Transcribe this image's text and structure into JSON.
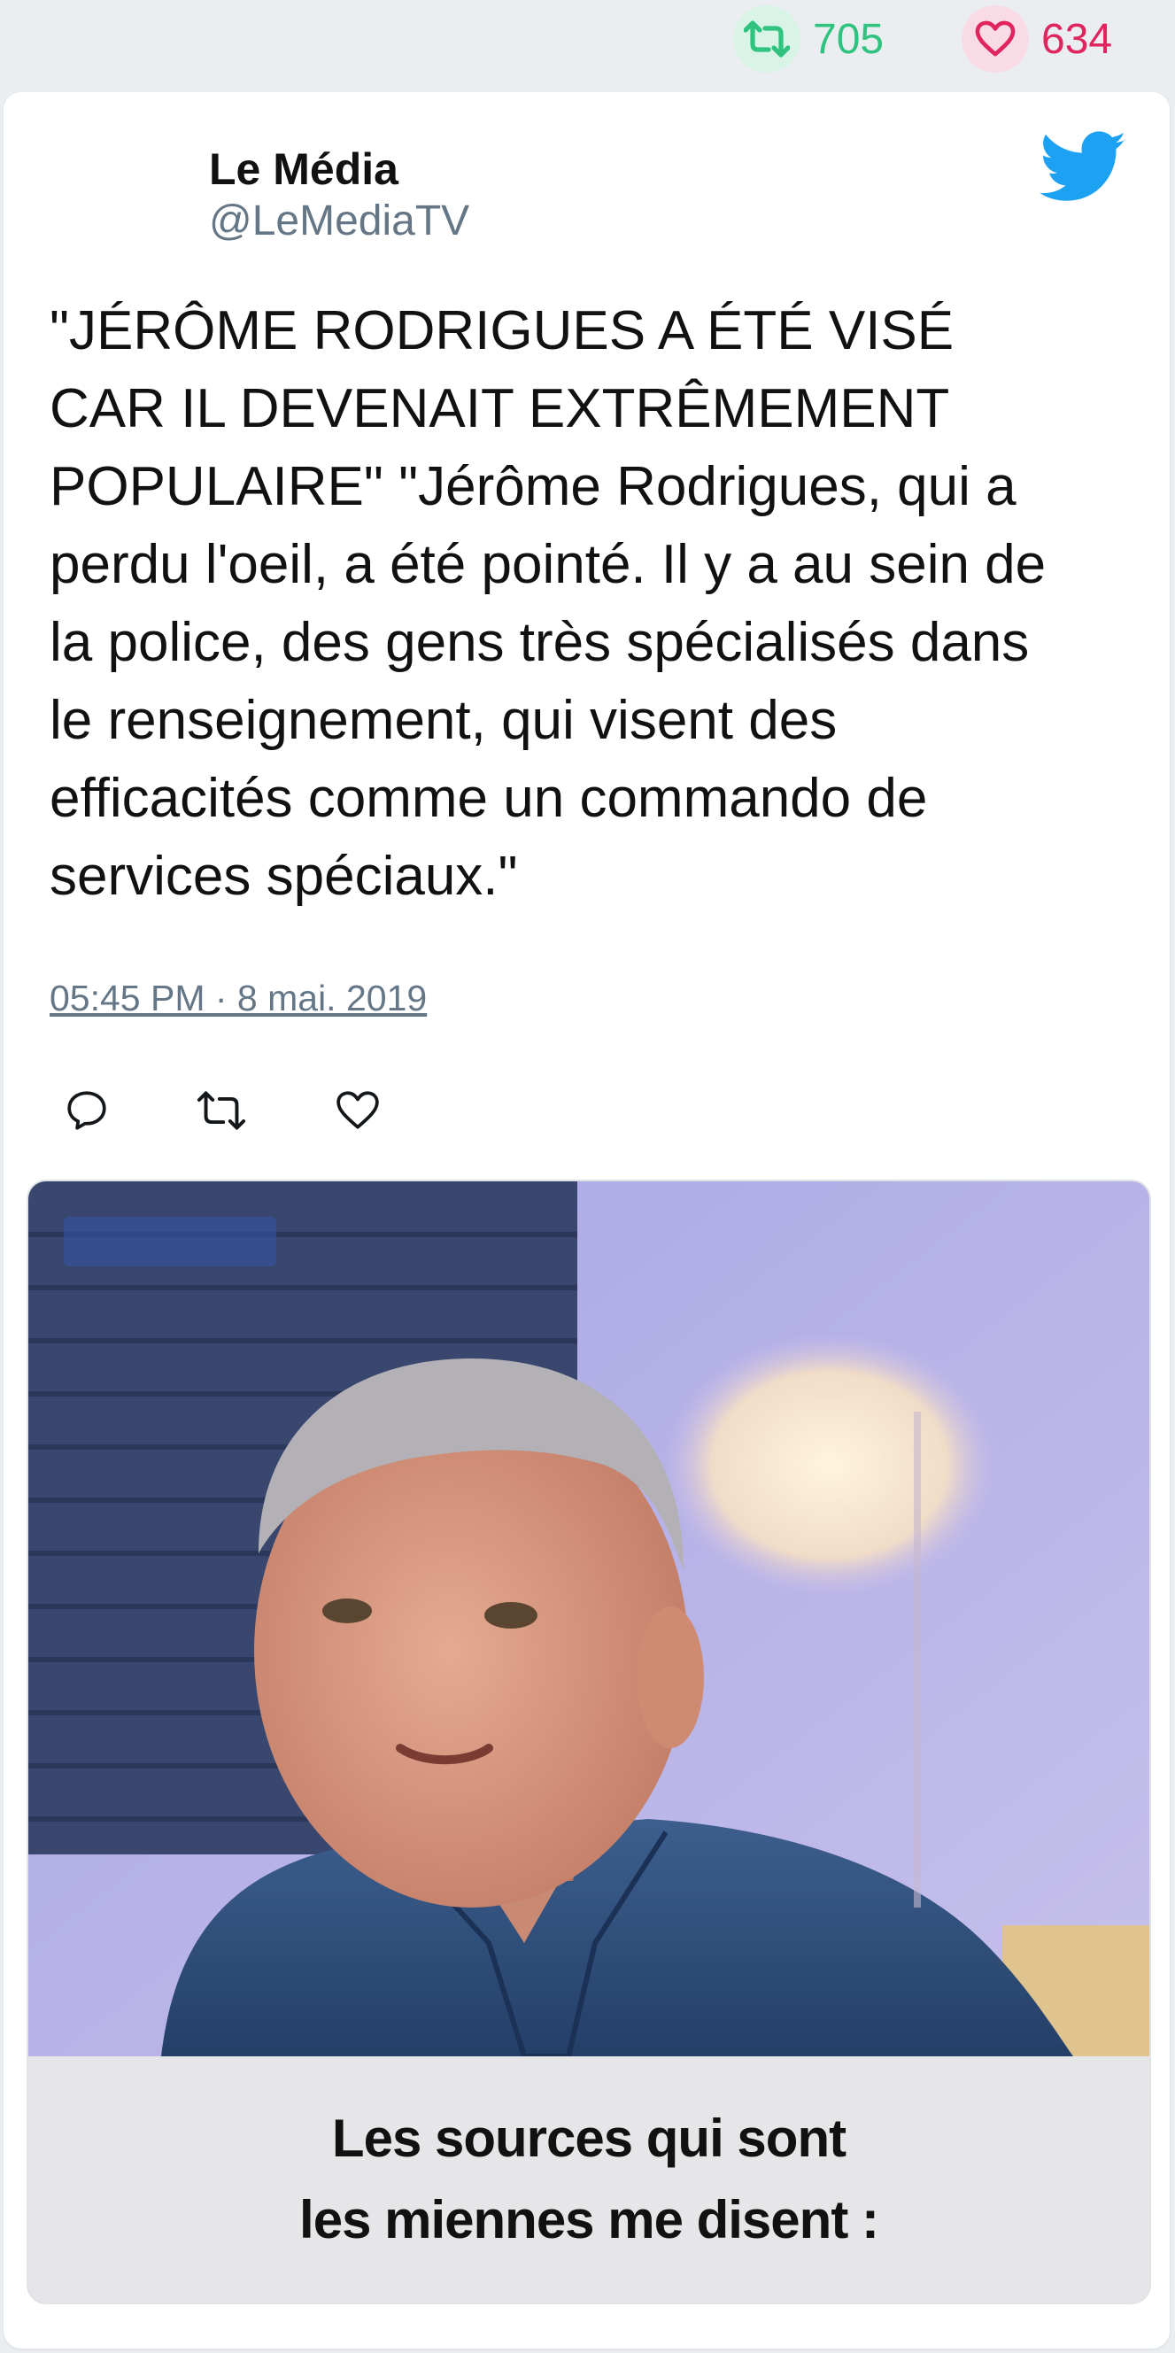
{
  "stats": {
    "retweets": "705",
    "likes": "634",
    "retweet_color": "#2fc37f",
    "like_color": "#e0245e",
    "retweet_icon": "retweet-icon",
    "like_icon": "heart-icon"
  },
  "tweet": {
    "author_name": "Le Média",
    "author_handle": "@LeMediaTV",
    "platform_icon": "twitter-bird-icon",
    "brand_color": "#1da1f2",
    "text": "\"JÉRÔME RODRIGUES A ÉTÉ VISÉ\nCAR IL DEVENAIT EXTRÊMEMENT\nPOPULAIRE\" \"Jérôme Rodrigues, qui a\nperdu l'oeil, a été pointé. Il y a au sein de\nla police, des gens très spécialisés dans\nle renseignement, qui visent des\nefficacités comme un commando de\nservices spéciaux.\"",
    "timestamp": "05:45 PM · 8 mai. 2019",
    "actions": [
      "reply-icon",
      "retweet-icon",
      "like-icon"
    ]
  },
  "media": {
    "caption_line1": "Les sources qui sont",
    "caption_line2": "les miennes me disent :"
  }
}
